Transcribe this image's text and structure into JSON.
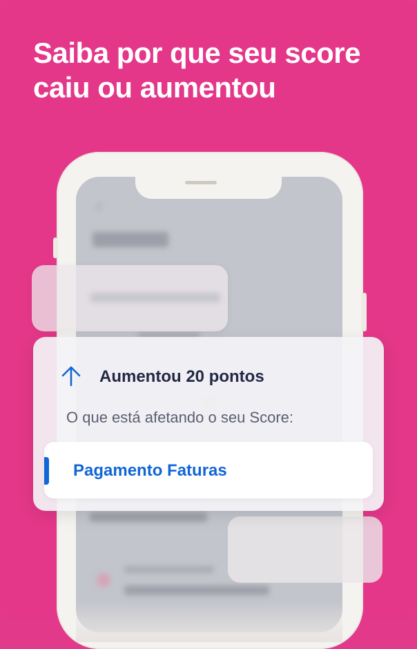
{
  "headline": "Saiba por que seu score caiu ou aumentou",
  "score_card": {
    "change_icon": "arrow-up-icon",
    "title": "Aumentou 20 pontos",
    "subtitle": "O que está afetando o seu Score:",
    "factor_label": "Pagamento Faturas"
  },
  "colors": {
    "background": "#e43789",
    "accent": "#1166d6",
    "title_text": "#232845"
  }
}
